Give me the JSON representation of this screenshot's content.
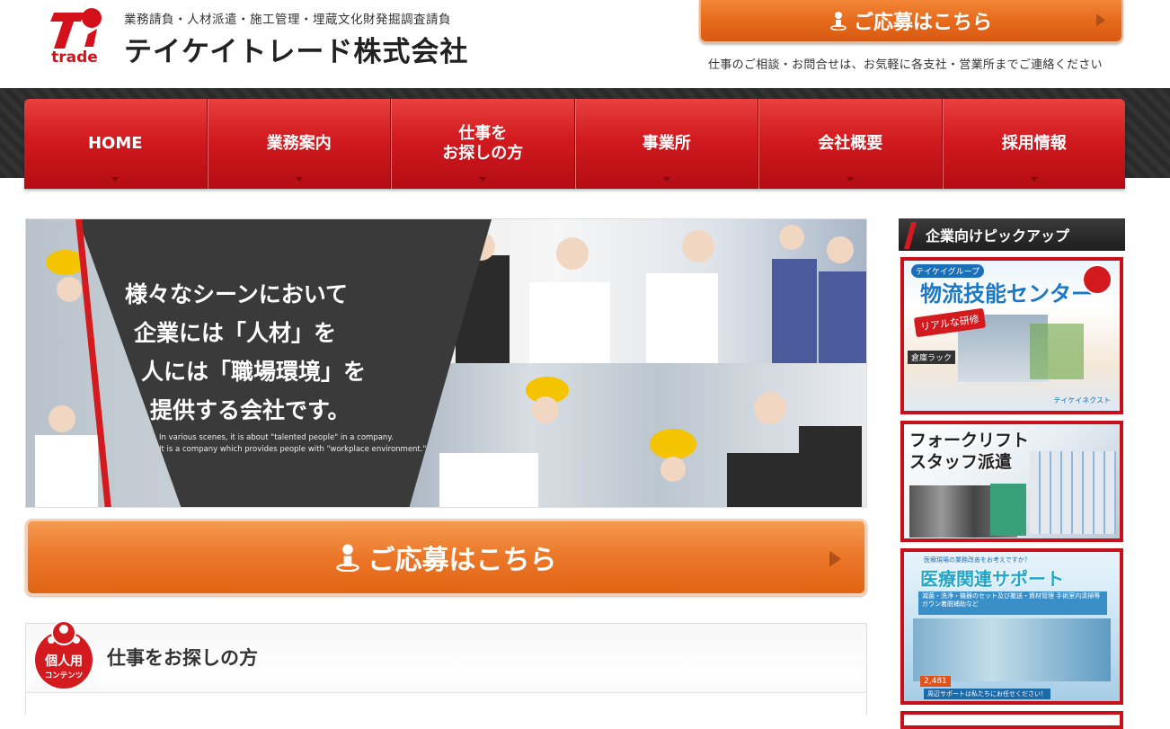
{
  "header": {
    "logo_text": "trade",
    "tagline": "業務請負・人材派遣・施工管理・埋蔵文化財発掘調査請負",
    "company_name": "テイケイトレード株式会社",
    "cta_label": "ご応募はこちら",
    "contact_note": "仕事のご相談・お問合せは、お気軽に各支社・営業所までご連絡ください"
  },
  "nav": {
    "items": [
      {
        "line1": "HOME",
        "line2": ""
      },
      {
        "line1": "業務案内",
        "line2": ""
      },
      {
        "line1": "仕事を",
        "line2": "お探しの方"
      },
      {
        "line1": "事業所",
        "line2": ""
      },
      {
        "line1": "会社概要",
        "line2": ""
      },
      {
        "line1": "採用情報",
        "line2": ""
      }
    ]
  },
  "hero": {
    "copy": [
      "様々なシーンにおいて",
      "企業には「人材」を",
      "人には「職場環境」を",
      "提供する会社です。"
    ],
    "copy_en": [
      "In various scenes, it is about \"talented people\" in a company.",
      "It is a company which provides people with \"workplace environment.\""
    ]
  },
  "main_cta": {
    "label": "ご応募はこちら"
  },
  "section": {
    "badge_line1": "個人用",
    "badge_line2": "コンテンツ",
    "title": "仕事をお探しの方"
  },
  "sidebar": {
    "title": "企業向けピックアップ",
    "banner1": {
      "small": "テイケイグループ",
      "big": "物流技能センター",
      "tag": "リアルな研修",
      "rack": "倉庫ラック",
      "logo": "テイケイネクスト"
    },
    "banner2": {
      "line1": "フォークリフト",
      "line2": "スタッフ派遣"
    },
    "banner3": {
      "tiny": "医療現場の業務改善をお考えですか？",
      "big": "医療関連サポート",
      "list": "滅菌・洗浄・機器のセット及び搬送・資材管理 手術室内清掃等 ガウン着脱補助など",
      "num": "2,481",
      "foot": "周辺サポートは私たちにお任せください！"
    }
  },
  "colors": {
    "brand_red": "#d21a1f",
    "cta_orange": "#ec7628",
    "nav_band": "#2e2e2e"
  }
}
